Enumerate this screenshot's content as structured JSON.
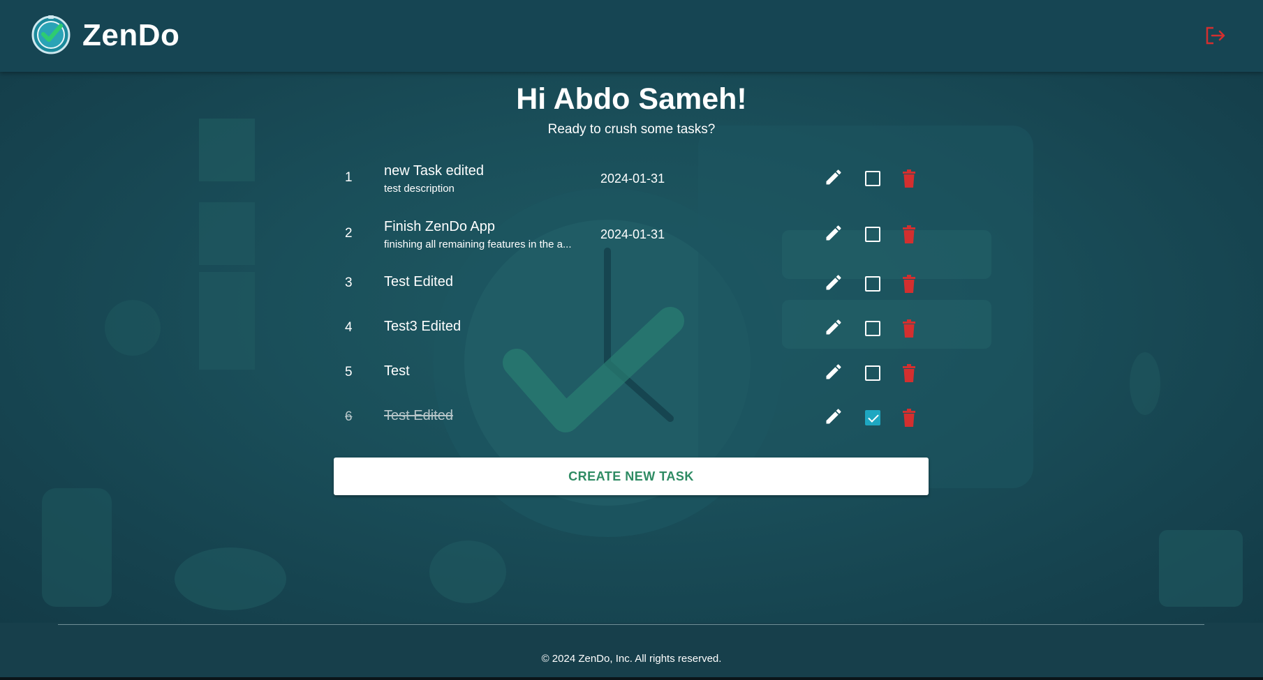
{
  "app": {
    "brand": "ZenDo"
  },
  "colors": {
    "accent": "#1ea7c1",
    "danger": "#d32f2f",
    "brand_green": "#2e8b63"
  },
  "greeting": {
    "title": "Hi Abdo Sameh!",
    "subtitle": "Ready to crush some tasks?"
  },
  "tasks": [
    {
      "num": "1",
      "title": "new Task edited",
      "description": "test description",
      "date": "2024-01-31",
      "completed": false
    },
    {
      "num": "2",
      "title": "Finish ZenDo App",
      "description": "finishing all remaining features in the a...",
      "date": "2024-01-31",
      "completed": false
    },
    {
      "num": "3",
      "title": "Test Edited",
      "description": "",
      "date": "",
      "completed": false
    },
    {
      "num": "4",
      "title": "Test3 Edited",
      "description": "",
      "date": "",
      "completed": false
    },
    {
      "num": "5",
      "title": "Test",
      "description": "",
      "date": "",
      "completed": false
    },
    {
      "num": "6",
      "title": "Test Edited",
      "description": "",
      "date": "",
      "completed": true
    }
  ],
  "actions": {
    "create_label": "CREATE NEW TASK"
  },
  "icons": {
    "edit": "pencil-icon",
    "checkbox": "checkbox-icon",
    "delete": "trash-icon",
    "logout": "logout-icon",
    "logo": "clock-check-logo-icon"
  },
  "footer": {
    "copyright": "© 2024 ZenDo, Inc. All rights reserved."
  }
}
